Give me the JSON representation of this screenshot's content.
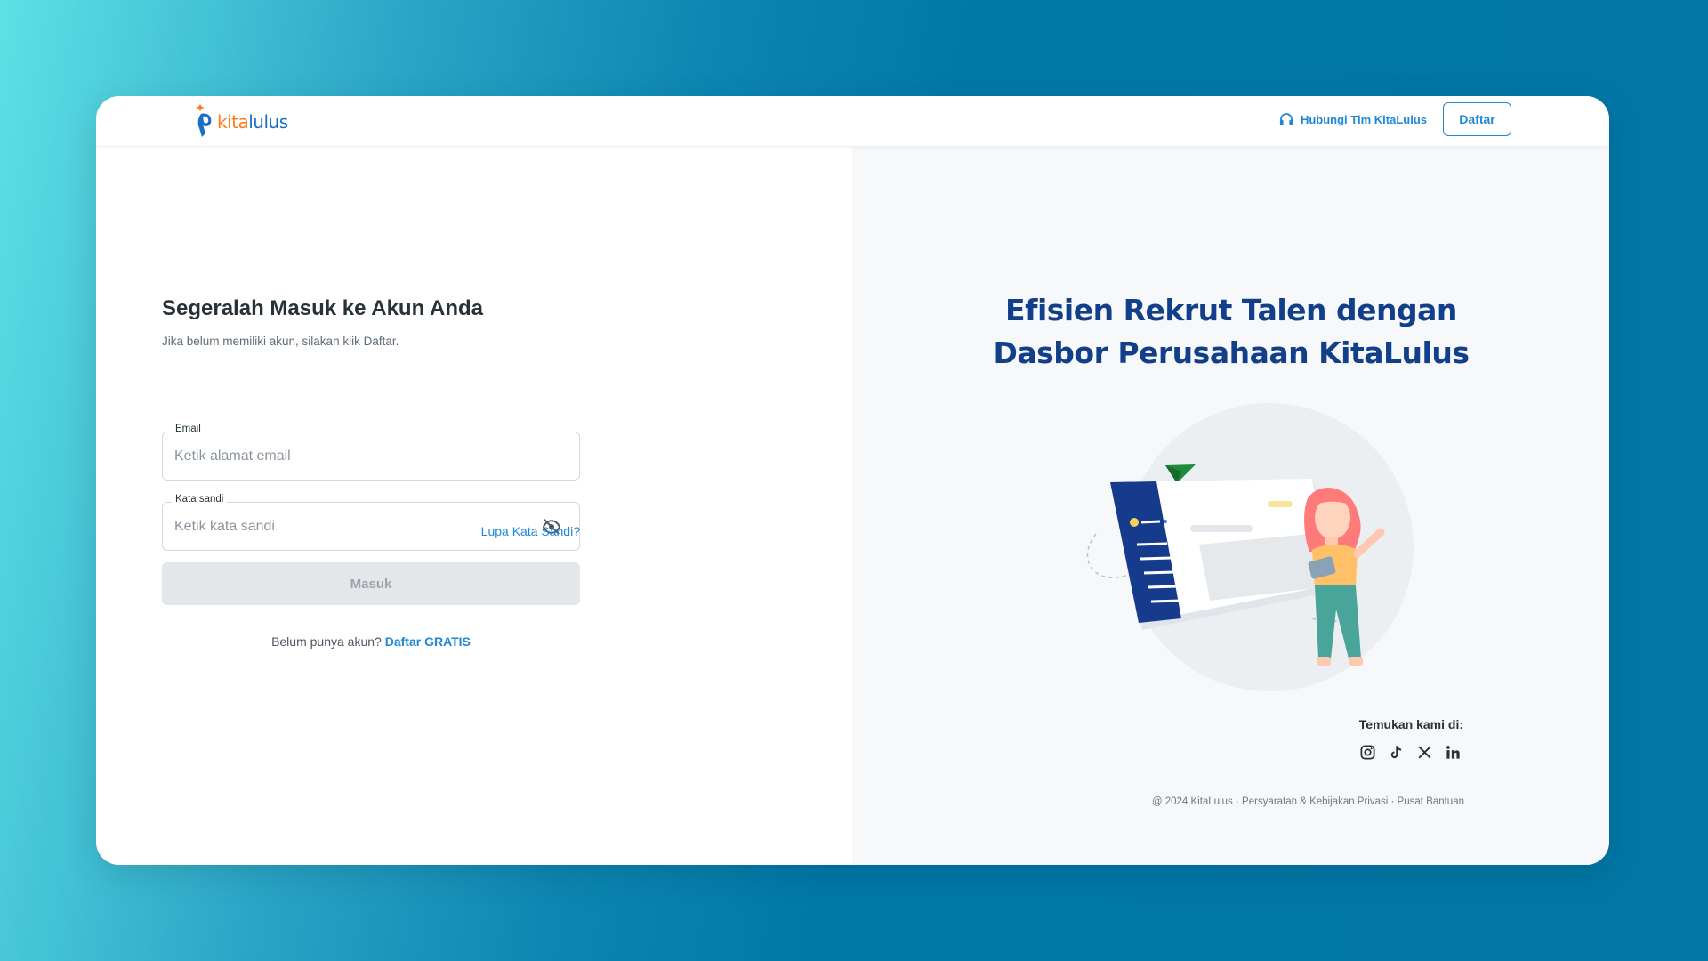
{
  "header": {
    "logo_kita": "kita",
    "logo_lulus": "lulus",
    "contact_label": "Hubungi Tim KitaLulus",
    "signup_button": "Daftar"
  },
  "login": {
    "title": "Segeralah Masuk ke Akun Anda",
    "subtitle": "Jika belum memiliki akun, silakan klik Daftar.",
    "email_label": "Email",
    "email_placeholder": "Ketik alamat email",
    "email_value": "",
    "password_label": "Kata sandi",
    "password_placeholder": "Ketik kata sandi",
    "password_value": "",
    "forgot_link": "Lupa Kata Sandi?",
    "submit_button": "Masuk",
    "no_account_text": "Belum punya akun?",
    "signup_link": "Daftar GRATIS"
  },
  "hero": {
    "title_line1": "Efisien Rekrut Talen dengan",
    "title_line2": "Dasbor Perusahaan KitaLulus"
  },
  "social": {
    "label": "Temukan kami di:",
    "icons": [
      "instagram-icon",
      "tiktok-icon",
      "x-icon",
      "linkedin-icon"
    ]
  },
  "footer": {
    "copyright": "@ 2024 KitaLulus",
    "sep1": " · ",
    "terms": "Persyaratan & Kebijakan Privasi",
    "sep2": " · ",
    "help": "Pusat Bantuan"
  },
  "colors": {
    "accent": "#1e88d6",
    "hero_title": "#113f8a",
    "logo_orange": "#ff7a1a",
    "logo_blue": "#1a6ec6"
  }
}
